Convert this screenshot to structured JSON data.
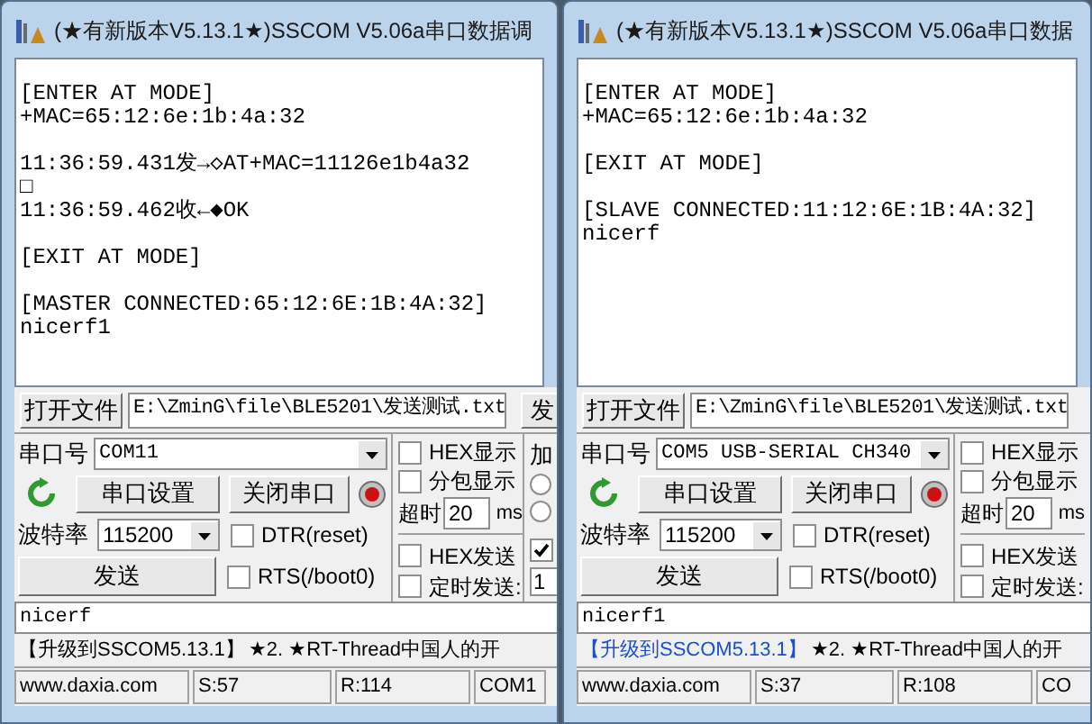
{
  "windows": [
    {
      "title": "(★有新版本V5.13.1★)SSCOM V5.06a串口数据调",
      "log_blocks": [
        [
          "[ENTER AT MODE]",
          "+MAC=65:12:6e:1b:4a:32"
        ],
        [
          "11:36:59.431发→◇AT+MAC=11126e1b4a32",
          "□",
          "11:36:59.462收←◆OK"
        ],
        [
          "[EXIT AT MODE]"
        ],
        [
          "[MASTER CONNECTED:65:12:6E:1B:4A:32]",
          "nicerf1"
        ]
      ],
      "open_file_button": "打开文件",
      "file_path": "E:\\ZminG\\file\\BLE5201\\发送测试.txt",
      "send_file_button": "发",
      "port_label": "串口号",
      "port": "COM11",
      "port_settings_button": "串口设置",
      "close_port_button": "关闭串口",
      "baud_label": "波特率",
      "baud": "115200",
      "send_button": "发送",
      "line_options": [
        {
          "label": "DTR(reset)",
          "checked": false
        },
        {
          "label": "RTS(/boot0)",
          "checked": false
        }
      ],
      "display_options": [
        {
          "label": "HEX显示",
          "checked": false
        },
        {
          "label": "分包显示",
          "checked": false
        }
      ],
      "timeout_label": "超时",
      "timeout": "20",
      "timeout_unit": "ms",
      "send_options": [
        {
          "label": "HEX发送",
          "checked": false
        },
        {
          "label": "定时发送:",
          "checked": false
        }
      ],
      "extra": {
        "label": "加",
        "radios": [
          {
            "selected": false
          },
          {
            "selected": false
          }
        ],
        "checked": true,
        "period": "1"
      },
      "send_input": "nicerf",
      "marquee": {
        "link": "【升级到SSCOM5.13.1】",
        "link_highlighted": false,
        "text": "★2. ★RT-Thread中国人的开"
      },
      "status": [
        "www.daxia.com",
        "S:57",
        "R:114",
        "COM1"
      ]
    },
    {
      "title": "(★有新版本V5.13.1★)SSCOM V5.06a串口数据",
      "log_blocks": [
        [
          "[ENTER AT MODE]",
          "+MAC=65:12:6e:1b:4a:32"
        ],
        [
          "[EXIT AT MODE]"
        ],
        [
          "[SLAVE CONNECTED:11:12:6E:1B:4A:32]",
          "nicerf"
        ]
      ],
      "open_file_button": "打开文件",
      "file_path": "E:\\ZminG\\file\\BLE5201\\发送测试.txt",
      "port_label": "串口号",
      "port": "COM5 USB-SERIAL CH340",
      "port_settings_button": "串口设置",
      "close_port_button": "关闭串口",
      "baud_label": "波特率",
      "baud": "115200",
      "send_button": "发送",
      "line_options": [
        {
          "label": "DTR(reset)",
          "checked": false
        },
        {
          "label": "RTS(/boot0)",
          "checked": false
        }
      ],
      "display_options": [
        {
          "label": "HEX显示",
          "checked": false
        },
        {
          "label": "分包显示",
          "checked": false
        }
      ],
      "timeout_label": "超时",
      "timeout": "20",
      "timeout_unit": "ms",
      "send_options": [
        {
          "label": "HEX发送",
          "checked": false
        },
        {
          "label": "定时发送:",
          "checked": false
        }
      ],
      "send_input": "nicerf1",
      "marquee": {
        "link": "【升级到SSCOM5.13.1】",
        "link_highlighted": true,
        "text": "★2. ★RT-Thread中国人的开"
      },
      "status": [
        "www.daxia.com",
        "S:37",
        "R:108",
        "CO"
      ]
    }
  ]
}
